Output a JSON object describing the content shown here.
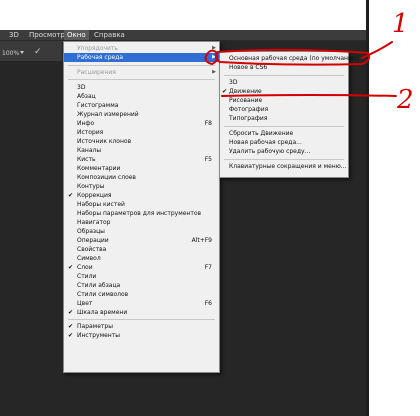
{
  "menubar": {
    "items": [
      "3D",
      "Просмотр",
      "Окно",
      "Справка"
    ]
  },
  "options_bar": {
    "zoom": "100%",
    "tool_icon": "brush-icon"
  },
  "window_menu": {
    "items": [
      {
        "label": "Упорядочить",
        "disabled": true,
        "submenu": true
      },
      {
        "label": "Рабочая среда",
        "highlighted": true,
        "submenu": true
      },
      {
        "label": "Расширения",
        "disabled": true,
        "submenu": true
      },
      {
        "label": "3D"
      },
      {
        "label": "Абзац"
      },
      {
        "label": "Гистограмма"
      },
      {
        "label": "Журнал измерений"
      },
      {
        "label": "Инфо",
        "shortcut": "F8"
      },
      {
        "label": "История"
      },
      {
        "label": "Источник клонов"
      },
      {
        "label": "Каналы"
      },
      {
        "label": "Кисть",
        "shortcut": "F5"
      },
      {
        "label": "Комментарии"
      },
      {
        "label": "Композиции слоев"
      },
      {
        "label": "Контуры"
      },
      {
        "label": "Коррекция",
        "checked": true
      },
      {
        "label": "Наборы кистей"
      },
      {
        "label": "Наборы параметров для инструментов"
      },
      {
        "label": "Навигатор"
      },
      {
        "label": "Образцы"
      },
      {
        "label": "Операции",
        "shortcut": "Alt+F9"
      },
      {
        "label": "Свойства"
      },
      {
        "label": "Символ"
      },
      {
        "label": "Слои",
        "checked": true,
        "shortcut": "F7"
      },
      {
        "label": "Стили"
      },
      {
        "label": "Стили абзаца"
      },
      {
        "label": "Стили символов"
      },
      {
        "label": "Цвет",
        "shortcut": "F6"
      },
      {
        "label": "Шкала времени",
        "checked": true
      },
      {
        "label": "Параметры",
        "checked": true
      },
      {
        "label": "Инструменты",
        "checked": true
      }
    ]
  },
  "workspace_submenu": {
    "items": [
      {
        "label": "Основная рабочая среда (по умолчанию)"
      },
      {
        "label": "Новое в CS6"
      },
      {
        "label": "3D"
      },
      {
        "label": "Движение",
        "checked": true
      },
      {
        "label": "Рисование"
      },
      {
        "label": "Фотография"
      },
      {
        "label": "Типография"
      },
      {
        "label": "Сбросить Движение"
      },
      {
        "label": "Новая рабочая среда..."
      },
      {
        "label": "Удалить рабочую среду..."
      },
      {
        "label": "Клавиатурные сокращения и меню..."
      }
    ]
  },
  "annotations": {
    "label_1": "1",
    "label_2": "2",
    "color": "#d40000"
  }
}
